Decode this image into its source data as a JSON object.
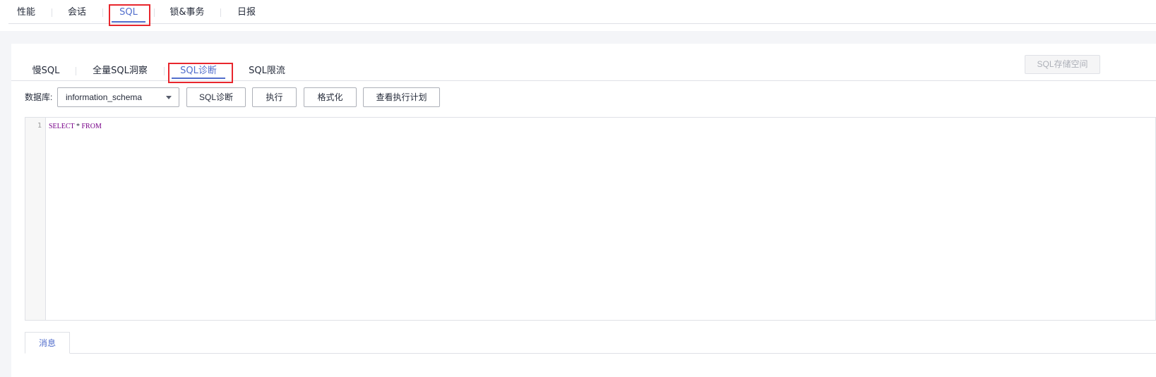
{
  "top_tabs": [
    {
      "label": "性能"
    },
    {
      "label": "会话"
    },
    {
      "label": "SQL"
    },
    {
      "label": "锁&事务"
    },
    {
      "label": "日报"
    }
  ],
  "top_active_tab": "SQL",
  "sub_tabs": [
    {
      "label": "慢SQL"
    },
    {
      "label": "全量SQL洞察"
    },
    {
      "label": "SQL诊断"
    },
    {
      "label": "SQL限流"
    }
  ],
  "sub_active_tab": "SQL诊断",
  "storage_button": {
    "label": "SQL存储空间"
  },
  "toolbar": {
    "db_label": "数据库:",
    "db_selected": "information_schema",
    "diagnose_label": "SQL诊断",
    "execute_label": "执行",
    "format_label": "格式化",
    "plan_label": "查看执行计划"
  },
  "editor": {
    "line_number": "1",
    "kw_select": "SELECT",
    "op_star": "*",
    "kw_from": "FROM"
  },
  "bottom_tabs": [
    {
      "label": "消息"
    }
  ],
  "colors": {
    "accent": "#526ecc",
    "highlight_box": "#e8262d",
    "keyword": "#770088"
  }
}
